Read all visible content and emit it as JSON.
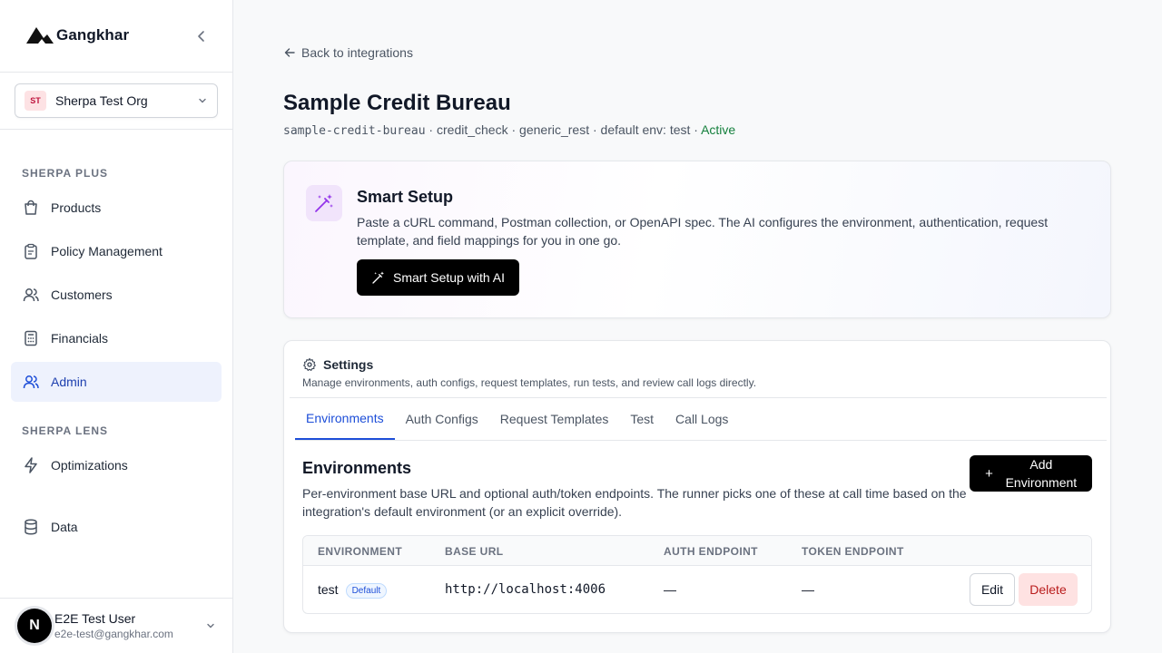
{
  "brand": {
    "name": "Gangkhar",
    "logo_icon": "mountain-logo-icon"
  },
  "org": {
    "initials": "ST",
    "name": "Sherpa Test Org"
  },
  "sidebar": {
    "section1": "SHERPA PLUS",
    "section2": "SHERPA LENS",
    "items": [
      {
        "label": "Products",
        "icon": "shopping-bag-icon"
      },
      {
        "label": "Policy Management",
        "icon": "clipboard-icon"
      },
      {
        "label": "Customers",
        "icon": "users-icon"
      },
      {
        "label": "Financials",
        "icon": "calculator-icon"
      },
      {
        "label": "Admin",
        "icon": "users-icon",
        "active": true
      },
      {
        "label": "Optimizations",
        "icon": "lightning-icon"
      },
      {
        "label": "Data",
        "icon": "database-icon"
      }
    ]
  },
  "user": {
    "initial": "N",
    "name": "E2E Test User",
    "email": "e2e-test@gangkhar.com"
  },
  "page": {
    "back_label": "Back to integrations",
    "title": "Sample Credit Bureau",
    "meta": {
      "slug": "sample-credit-bureau",
      "sep": " · ",
      "category": "credit_check",
      "type": "generic_rest",
      "default_env": "default env: test",
      "status": "Active"
    }
  },
  "smart_setup": {
    "title": "Smart Setup",
    "description": "Paste a cURL command, Postman collection, or OpenAPI spec. The AI configures the environment, authentication, request template, and field mappings for you in one go.",
    "button_label": "Smart Setup with AI"
  },
  "settings": {
    "title": "Settings",
    "description": "Manage environments, auth configs, request templates, run tests, and review call logs directly.",
    "tabs": [
      "Environments",
      "Auth Configs",
      "Request Templates",
      "Test",
      "Call Logs"
    ],
    "active_tab": 0
  },
  "environments": {
    "title": "Environments",
    "description": "Per-environment base URL and optional auth/token endpoints. The runner picks one of these at call time based on the integration's default environment (or an explicit override).",
    "add_plus": "+",
    "add_label": "Add Environment",
    "columns": [
      "ENVIRONMENT",
      "BASE URL",
      "AUTH ENDPOINT",
      "TOKEN ENDPOINT"
    ],
    "rows": [
      {
        "name": "test",
        "badge": "Default",
        "base_url": "http://localhost:4006",
        "auth_endpoint": "—",
        "token_endpoint": "—"
      }
    ],
    "edit_label": "Edit",
    "delete_label": "Delete"
  },
  "colors": {
    "accent": "#1d4ed8",
    "active_status": "#15803d",
    "danger": "#b91c1c",
    "sidebar_active_bg": "#eef2fd"
  }
}
